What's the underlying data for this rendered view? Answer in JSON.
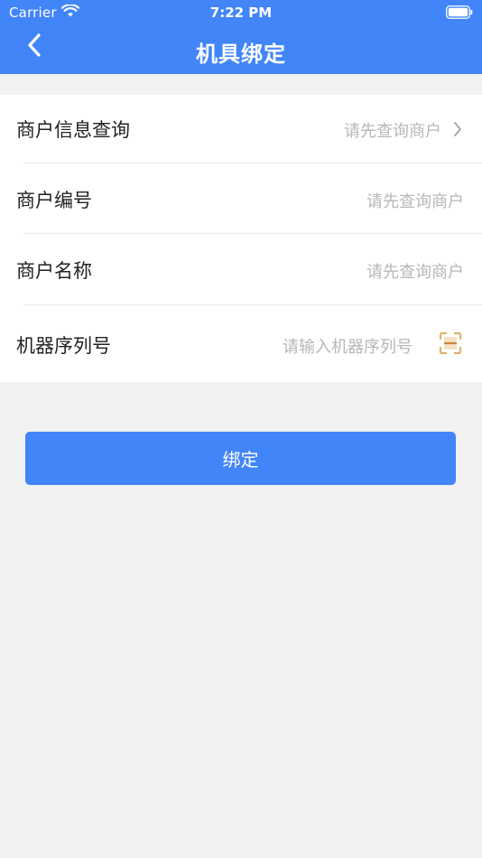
{
  "status_bar": {
    "carrier": "Carrier",
    "time": "7:22 PM"
  },
  "nav": {
    "title": "机具绑定",
    "back_icon": "chevron-left-icon"
  },
  "form": {
    "rows": [
      {
        "label": "商户信息查询",
        "value": "请先查询商户",
        "icon": "chevron-right-icon"
      },
      {
        "label": "商户编号",
        "value": "请先查询商户"
      },
      {
        "label": "商户名称",
        "value": "请先查询商户"
      },
      {
        "label": "机器序列号",
        "placeholder": "请输入机器序列号",
        "icon": "scan-icon"
      }
    ]
  },
  "actions": {
    "bind_label": "绑定"
  },
  "colors": {
    "primary": "#4285f8",
    "background": "#f2f2f2",
    "placeholder": "#b7b7b7",
    "scan_icon": "#e0b06a"
  }
}
